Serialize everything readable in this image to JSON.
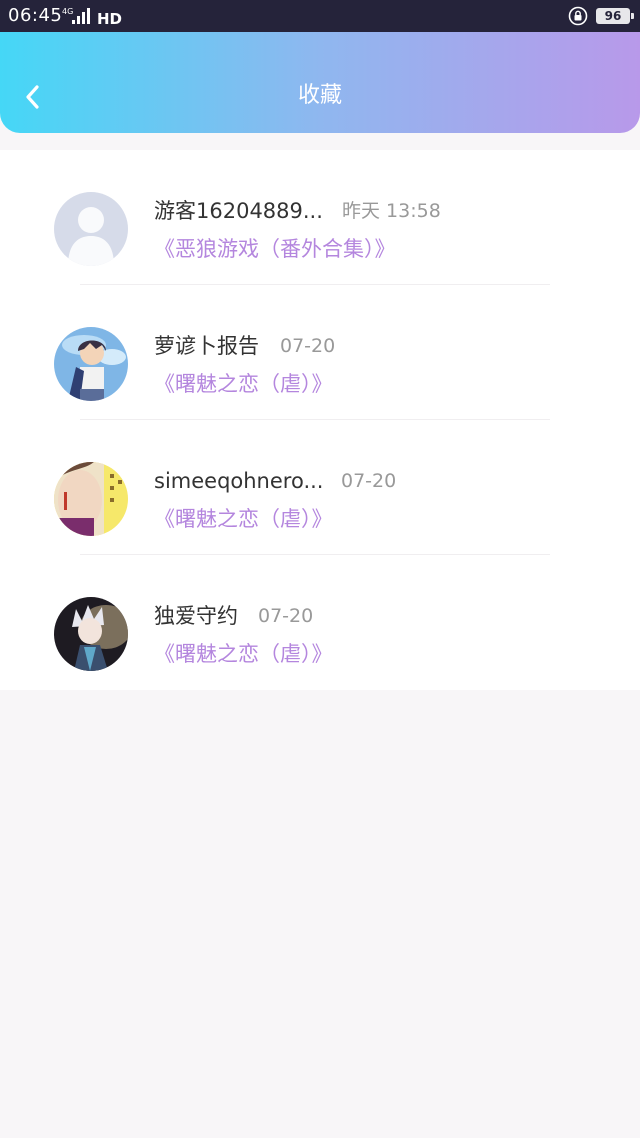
{
  "status_bar": {
    "time": "06:45",
    "network": "4G",
    "network_hd": "HD",
    "battery": "96"
  },
  "header": {
    "title": "收藏"
  },
  "items": [
    {
      "name": "游客16204889...",
      "time": "昨天 13:58",
      "book": "《恶狼游戏（番外合集）》"
    },
    {
      "name": "萝谚卜报告",
      "time": "07-20",
      "book": "《曙魅之恋（虐）》"
    },
    {
      "name": "simeeqohnero...",
      "time": "07-20",
      "book": "《曙魅之恋（虐）》"
    },
    {
      "name": "独爱守约",
      "time": "07-20",
      "book": "《曙魅之恋（虐）》"
    }
  ],
  "colors": {
    "header_gradient_start": "#45d7f6",
    "header_gradient_end": "#b899ea",
    "book_title": "#b486de",
    "status_bar": "#25233a"
  }
}
